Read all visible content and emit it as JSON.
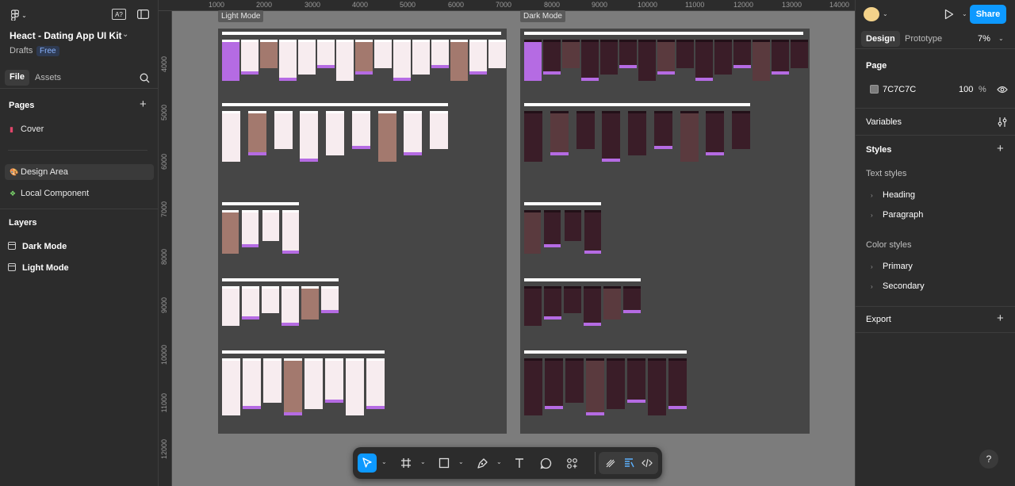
{
  "left": {
    "file_title": "Heact - Dating App UI Kit",
    "location": "Drafts",
    "plan_badge": "Free",
    "tabs": [
      "File",
      "Assets"
    ],
    "pages_label": "Pages",
    "pages": [
      {
        "label": "Cover",
        "icon": "red-book-icon"
      },
      {
        "label": "Design Area",
        "icon": "palette-icon"
      },
      {
        "label": "Local Component",
        "icon": "component-icon"
      }
    ],
    "layers_label": "Layers",
    "layers": [
      "Dark Mode",
      "Light Mode"
    ]
  },
  "canvas": {
    "ruler_x": [
      "1000",
      "2000",
      "3000",
      "4000",
      "5000",
      "6000",
      "7000",
      "8000",
      "9000",
      "10000",
      "11000",
      "12000",
      "13000",
      "14000"
    ],
    "ruler_y": [
      "4000",
      "5000",
      "6000",
      "7000",
      "8000",
      "9000",
      "10000",
      "11000",
      "12000"
    ],
    "frames": [
      {
        "label": "Light Mode",
        "theme": "light"
      },
      {
        "label": "Dark Mode",
        "theme": "dark"
      }
    ],
    "background": "#7C7C7C"
  },
  "toolbar": {
    "tools": [
      "move-icon",
      "frame-icon",
      "rectangle-icon",
      "pen-icon",
      "text-icon",
      "comment-icon",
      "actions-icon"
    ],
    "dev_tools": [
      "draw-icon",
      "design-mode-icon",
      "dev-mode-icon"
    ]
  },
  "right": {
    "share_label": "Share",
    "tabs": [
      "Design",
      "Prototype"
    ],
    "zoom": "7%",
    "page_label": "Page",
    "page_color": "7C7C7C",
    "page_opacity": "100",
    "page_opacity_unit": "%",
    "variables_label": "Variables",
    "styles_label": "Styles",
    "text_styles_label": "Text styles",
    "text_styles": [
      "Heading",
      "Paragraph"
    ],
    "color_styles_label": "Color styles",
    "color_styles": [
      "Primary",
      "Secondary"
    ],
    "export_label": "Export",
    "help_label": "?"
  },
  "colors": {
    "accent": "#0D99FF",
    "panel": "#2C2C2C",
    "brand_purple": "#B56BE3"
  }
}
